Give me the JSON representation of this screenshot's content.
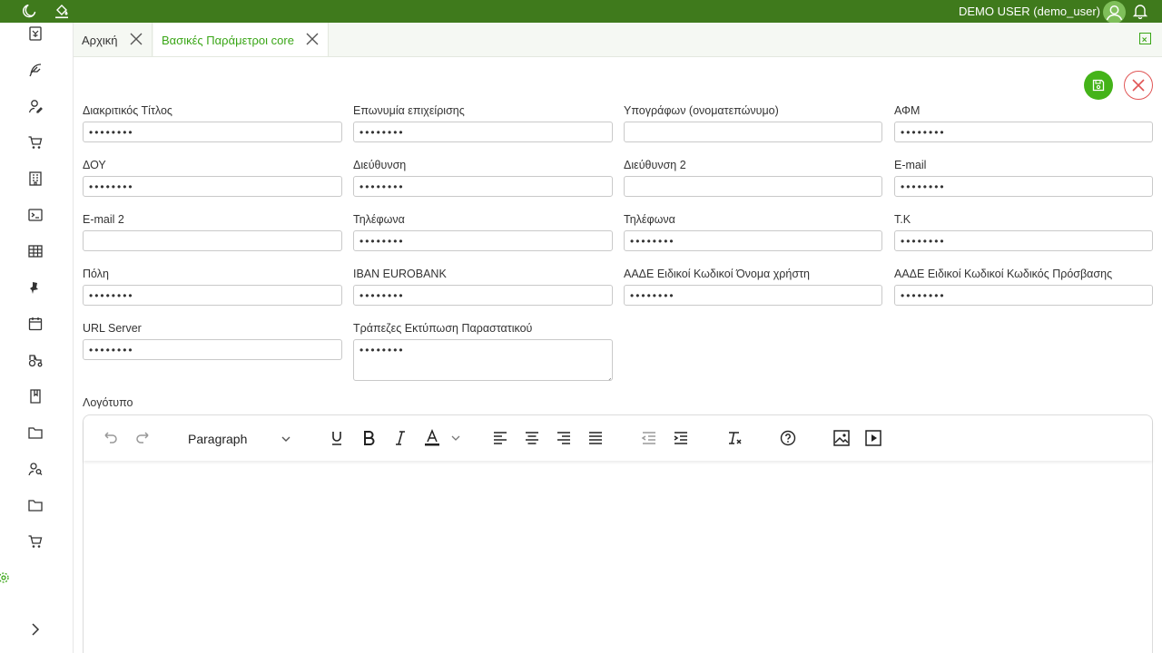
{
  "topbar": {
    "user_label": "DEMO USER (demo_user)",
    "icons": [
      "moon-icon",
      "paint-bucket-icon",
      "avatar-icon",
      "bell-icon"
    ]
  },
  "sidebar": {
    "icons": [
      "calculator-icon",
      "feather-icon",
      "user-edit-icon",
      "cart-icon",
      "building-icon",
      "terminal-icon",
      "table-icon",
      "pin-icon",
      "calendar-icon",
      "tractor-icon",
      "book-icon",
      "folder-icon",
      "user-search-icon",
      "folder-icon",
      "cart-icon"
    ],
    "active_icon": "gear-icon",
    "expand_icon": "chevron-right-icon"
  },
  "tabs": [
    {
      "label": "Αρχική",
      "active": false
    },
    {
      "label": "Βασικές Παράμετροι core",
      "active": true
    }
  ],
  "colors": {
    "brand": "#3f7a1c",
    "accent": "#44b319",
    "danger": "#e05555"
  },
  "form": {
    "fields": [
      {
        "label": "Διακριτικός Τίτλος",
        "value": "••••••••"
      },
      {
        "label": "Επωνυμία επιχείρισης",
        "value": "••••••••"
      },
      {
        "label": "Υπογράφων (ονοματεπώνυμο)",
        "value": ""
      },
      {
        "label": "ΑΦΜ",
        "value": "••••••••"
      },
      {
        "label": "ΔΟΥ",
        "value": "••••••••"
      },
      {
        "label": "Διεύθυνση",
        "value": "••••••••"
      },
      {
        "label": "Διεύθυνση 2",
        "value": ""
      },
      {
        "label": "E-mail",
        "value": "••••••••"
      },
      {
        "label": "E-mail 2",
        "value": ""
      },
      {
        "label": "Τηλέφωνα",
        "value": "••••••••"
      },
      {
        "label": "Τηλέφωνα",
        "value": "••••••••"
      },
      {
        "label": "Τ.Κ",
        "value": "••••••••"
      },
      {
        "label": "Πόλη",
        "value": "••••••••"
      },
      {
        "label": "IBAN EUROBANK",
        "value": "••••••••"
      },
      {
        "label": "ΑΑΔΕ Ειδικοί Κωδικοί Όνομα χρήστη",
        "value": "••••••••"
      },
      {
        "label": "ΑΑΔΕ Ειδικοί Κωδικοί Κωδικός Πρόσβασης",
        "value": "••••••••"
      },
      {
        "label": "URL Server",
        "value": "••••••••"
      },
      {
        "label": "Τράπεζες Εκτύπωση Παραστατικού",
        "value": "••••••••"
      }
    ],
    "logo_label": "Λογότυπο"
  },
  "editor": {
    "block_format": "Paragraph",
    "toolbar_icons": [
      "undo-icon",
      "redo-icon",
      "underline-icon",
      "bold-icon",
      "italic-icon",
      "text-color-icon",
      "align-left-icon",
      "align-center-icon",
      "align-right-icon",
      "align-justify-icon",
      "outdent-icon",
      "indent-icon",
      "clear-formatting-icon",
      "help-icon",
      "image-icon",
      "media-icon"
    ]
  }
}
